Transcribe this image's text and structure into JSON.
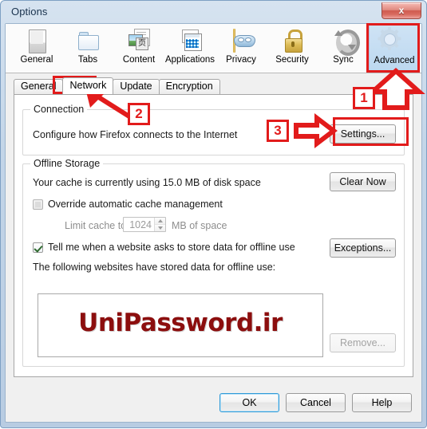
{
  "window": {
    "title": "Options",
    "close_label": "x"
  },
  "toolbar": {
    "panes": [
      {
        "label": "General",
        "icon": "general-icon"
      },
      {
        "label": "Tabs",
        "icon": "tabs-icon"
      },
      {
        "label": "Content",
        "icon": "content-icon",
        "badge": "页"
      },
      {
        "label": "Applications",
        "icon": "applications-icon"
      },
      {
        "label": "Privacy",
        "icon": "privacy-mask-icon"
      },
      {
        "label": "Security",
        "icon": "padlock-icon"
      },
      {
        "label": "Sync",
        "icon": "sync-refresh-icon"
      },
      {
        "label": "Advanced",
        "icon": "gear-icon",
        "selected": true
      }
    ]
  },
  "tabs": [
    {
      "label": "General"
    },
    {
      "label": "Network",
      "active": true
    },
    {
      "label": "Update"
    },
    {
      "label": "Encryption"
    }
  ],
  "connection": {
    "group_title": "Connection",
    "description": "Configure how Firefox connects to the Internet",
    "settings_button": "Settings..."
  },
  "offline_storage": {
    "group_title": "Offline Storage",
    "cache_usage_text": "Your cache is currently using 15.0 MB of disk space",
    "clear_now_button": "Clear Now",
    "override_checkbox_label": "Override automatic cache management",
    "override_checked": false,
    "limit_cache_label": "Limit cache to",
    "limit_cache_value": "1024",
    "limit_cache_unit": "MB of space",
    "tell_me_checkbox_label": "Tell me when a website asks to store data for offline use",
    "tell_me_checked": true,
    "exceptions_button": "Exceptions...",
    "stored_sites_label": "The following websites have stored data for offline use:",
    "site_list": [
      "UniPassword.ir"
    ],
    "remove_button": "Remove..."
  },
  "dialog_buttons": {
    "ok": "OK",
    "cancel": "Cancel",
    "help": "Help"
  },
  "annotations": {
    "step1": "1",
    "step2": "2",
    "step3": "3",
    "color": "#e21b1b"
  }
}
